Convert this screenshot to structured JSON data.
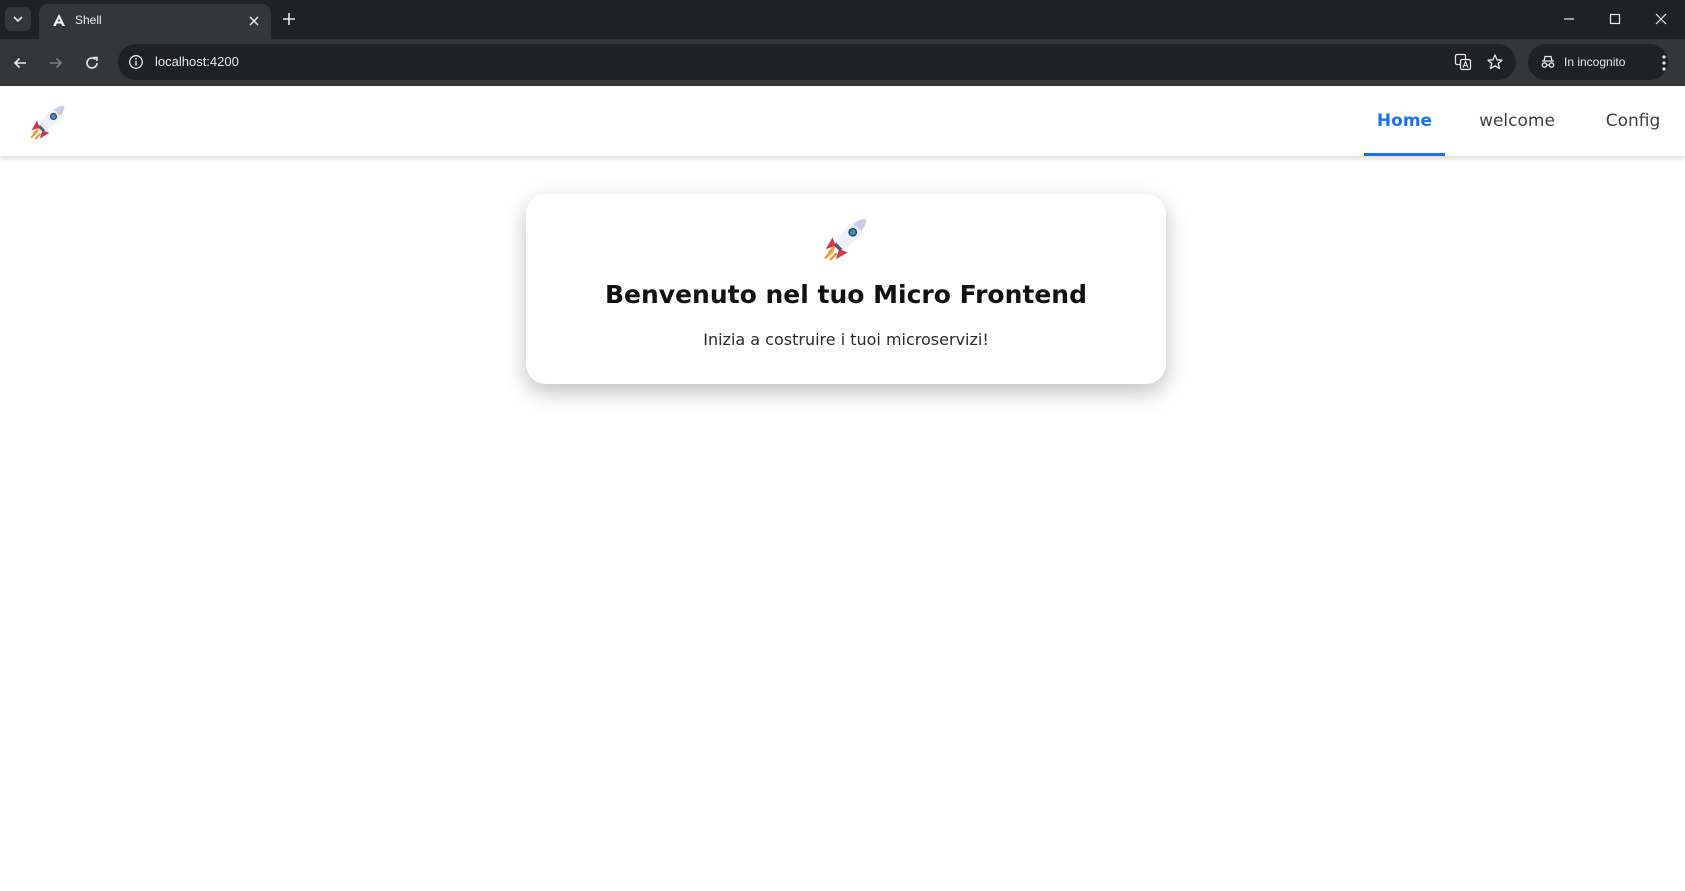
{
  "browser": {
    "tab": {
      "title": "Shell",
      "favicon": "angular-icon"
    },
    "address": {
      "url": "localhost:4200"
    },
    "incognito_label": "In incognito",
    "colors": {
      "chrome_dark": "#202124",
      "chrome_mid": "#35363a",
      "text": "#e8eaed"
    }
  },
  "app": {
    "logo": "rocket-icon",
    "nav": {
      "items": [
        {
          "label": "Home",
          "active": true
        },
        {
          "label": "welcome",
          "active": false
        },
        {
          "label": "Config",
          "active": false
        }
      ]
    },
    "card": {
      "icon": "rocket-icon",
      "title": "Benvenuto nel tuo Micro Frontend",
      "subtitle": "Inizia a costruire i tuoi microservizi!"
    },
    "colors": {
      "accent": "#1a73e8"
    }
  }
}
